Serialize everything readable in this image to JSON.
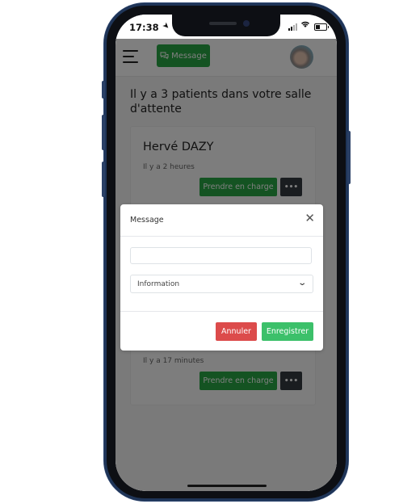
{
  "status_bar": {
    "time": "17:38",
    "location_icon": "location-arrow-icon",
    "signal_icon": "cellular-signal-icon",
    "wifi_icon": "wifi-icon",
    "battery_icon": "battery-icon"
  },
  "navbar": {
    "menu_icon": "hamburger-menu-icon",
    "message_button": {
      "icon": "chat-bubbles-icon",
      "label": "Message",
      "color": "#28a745"
    },
    "avatar": "user-avatar"
  },
  "main": {
    "heading": "Il y a 3 patients dans votre salle d'attente",
    "patients": [
      {
        "name": "Hervé DAZY",
        "waiting_time": "Il y a 2 heures",
        "take_charge_label": "Prendre en charge",
        "more_label": "•••"
      },
      {
        "name": "",
        "waiting_time": "Il y a 17 minutes",
        "take_charge_label": "Prendre en charge",
        "more_label": "•••"
      }
    ]
  },
  "modal": {
    "title": "Message",
    "close_label": "✕",
    "text_input": {
      "value": "",
      "placeholder": ""
    },
    "select": {
      "selected": "Information"
    },
    "cancel_label": "Annuler",
    "save_label": "Enregistrer",
    "colors": {
      "cancel": "#dc4b4b",
      "save": "#3cc06a"
    }
  }
}
